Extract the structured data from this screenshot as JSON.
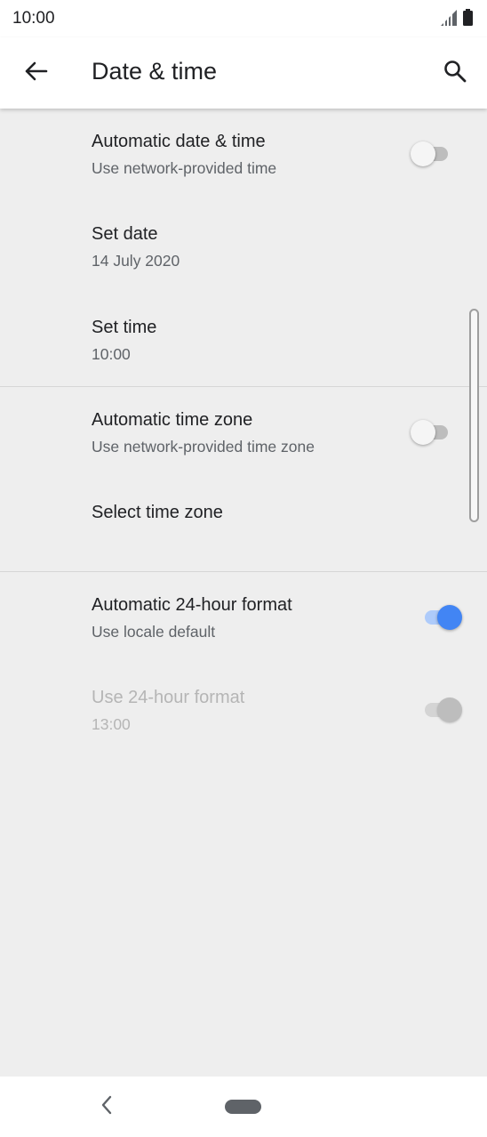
{
  "status_bar": {
    "time": "10:00"
  },
  "app_bar": {
    "title": "Date & time"
  },
  "icons": {
    "back": "arrow-left-icon",
    "search": "search-icon",
    "signal": "signal-icon",
    "battery": "battery-icon",
    "nav_back": "chevron-left-icon"
  },
  "colors": {
    "accent": "#4285f4",
    "accent_track": "#aecbfa",
    "background": "#eeeeee"
  },
  "settings": {
    "auto_date_time": {
      "title": "Automatic date & time",
      "summary": "Use network-provided time",
      "enabled": false
    },
    "set_date": {
      "title": "Set date",
      "summary": "14 July 2020"
    },
    "set_time": {
      "title": "Set time",
      "summary": "10:00"
    },
    "auto_time_zone": {
      "title": "Automatic time zone",
      "summary": "Use network-provided time zone",
      "enabled": false
    },
    "select_time_zone": {
      "title": "Select time zone"
    },
    "auto_24h": {
      "title": "Automatic 24-hour format",
      "summary": "Use locale default",
      "enabled": true
    },
    "use_24h": {
      "title": "Use 24-hour format",
      "summary": "13:00",
      "enabled": true,
      "disabled": true
    }
  }
}
